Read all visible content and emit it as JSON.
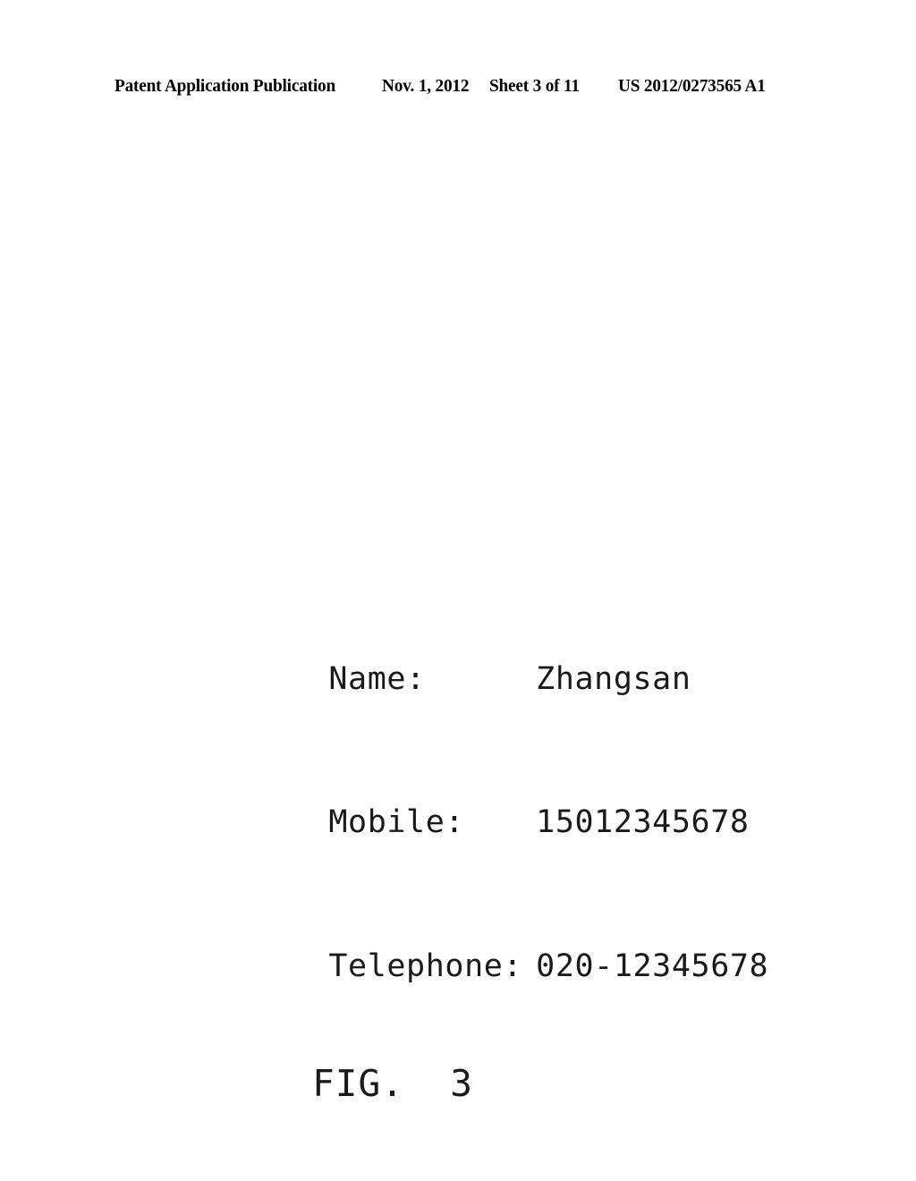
{
  "header": {
    "publication": "Patent Application Publication",
    "date": "Nov. 1, 2012",
    "sheet": "Sheet 3 of 11",
    "document_number": "US 2012/0273565 A1"
  },
  "figure": {
    "caption": "FIG.  3",
    "rows": [
      {
        "label": "Name:",
        "value": "Zhangsan"
      },
      {
        "label": "Mobile:",
        "value": "15012345678"
      },
      {
        "label": "Telephone:",
        "value": "020-12345678"
      }
    ]
  },
  "colors": {
    "page_background": "#ffffff",
    "ink": "#000000",
    "figure_ink": "#1a1a1a"
  }
}
